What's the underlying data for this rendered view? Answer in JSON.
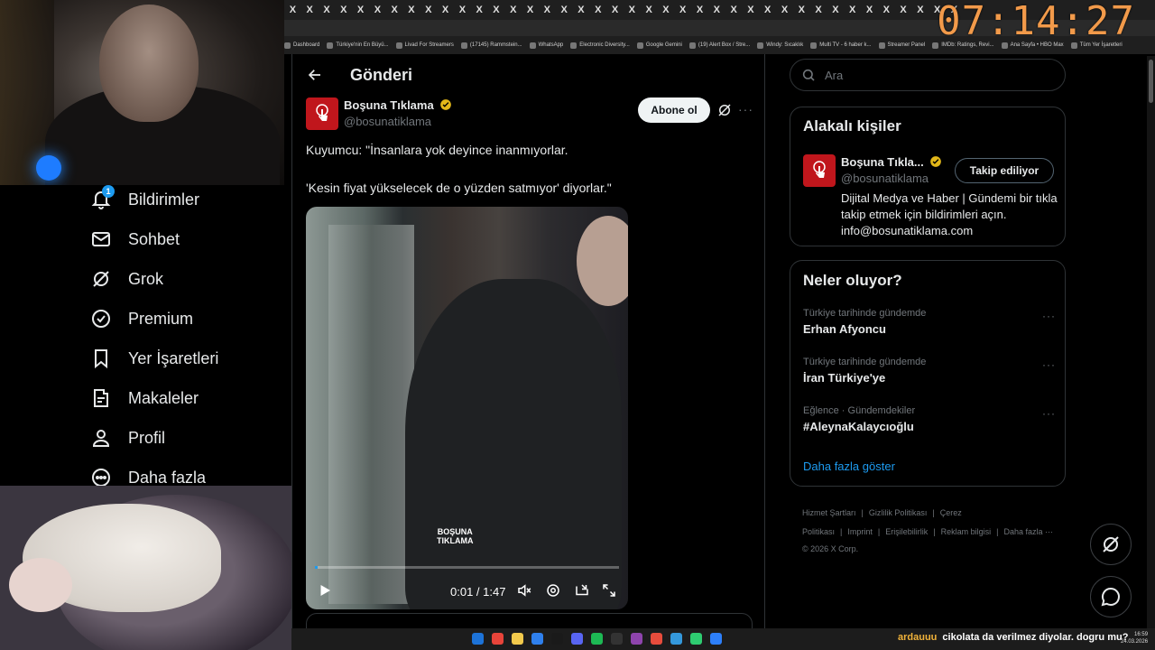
{
  "clock": "07:14:27",
  "tabs_count": 40,
  "bookmarks": [
    "Dashboard",
    "Türkiye'nin En Büyü...",
    "Livad For Streamers",
    "(17145) Rammstein...",
    "WhatsApp",
    "Electronic Diversity...",
    "Google Gemini",
    "(19) Alert Box / Stre...",
    "Windy: Sıcaklık",
    "Multi TV - 6 haber k...",
    "Streamer Panel",
    "IMDb: Ratings, Revi...",
    "Ana Sayfa • HBO Max",
    "Tüm Yer İşaretleri"
  ],
  "nav": {
    "notifications": "Bildirimler",
    "notif_badge": "1",
    "chat": "Sohbet",
    "grok": "Grok",
    "premium": "Premium",
    "bookmarks": "Yer İşaretleri",
    "articles": "Makaleler",
    "profile": "Profil",
    "more": "Daha fazla"
  },
  "post": {
    "page_title": "Gönderi",
    "author_name": "Boşuna Tıklama",
    "author_handle": "@bosunatiklama",
    "subscribe_label": "Abone ol",
    "more": "···",
    "line1": "Kuyumcu: \"İnsanlara yok deyince inanmıyorlar.",
    "line2": "'Kesin fiyat yükselecek de o yüzden satmıyor' diyorlar.\"",
    "video_time": "0:01 / 1:47",
    "watermark_top": "BOŞUNA",
    "watermark_bottom": "TIKLAMA",
    "progress": 0.01
  },
  "search": {
    "placeholder": "Ara"
  },
  "related": {
    "title": "Alakalı kişiler",
    "name": "Boşuna Tıkla...",
    "handle": "@bosunatiklama",
    "follow_label": "Takip ediliyor",
    "bio": "Dijital Medya ve Haber | Gündemi bir tıkla takip etmek için bildirimleri açın. info@bosunatiklama.com"
  },
  "trends": {
    "title": "Neler oluyor?",
    "items": [
      {
        "context": "Türkiye tarihinde gündemde",
        "title": "Erhan Afyoncu"
      },
      {
        "context": "Türkiye tarihinde gündemde",
        "title": "İran Türkiye'ye"
      },
      {
        "context": "Eğlence · Gündemdekiler",
        "title": "#AleynaKalaycıoğlu"
      }
    ],
    "show_more": "Daha fazla göster",
    "dots": "···"
  },
  "footer": {
    "links": [
      "Hizmet Şartları",
      "|",
      "Gizlilik Politikası",
      "|",
      "Çerez Politikası",
      "|",
      "Imprint",
      "|",
      "Erişilebilirlik",
      "|",
      "Reklam bilgisi",
      "|",
      "Daha fazla ···"
    ],
    "copyright": "© 2026 X Corp."
  },
  "chat": {
    "user": "ardauuu",
    "message": "cikolata da verilmez diyolar. dogru mu?"
  },
  "tray": {
    "time": "16:59",
    "date": "24.03.2026"
  },
  "colors": {
    "accent": "#1d9bf0",
    "clock": "#f29a4a",
    "brand_red": "#c0161c",
    "verified": "#e2b719"
  }
}
